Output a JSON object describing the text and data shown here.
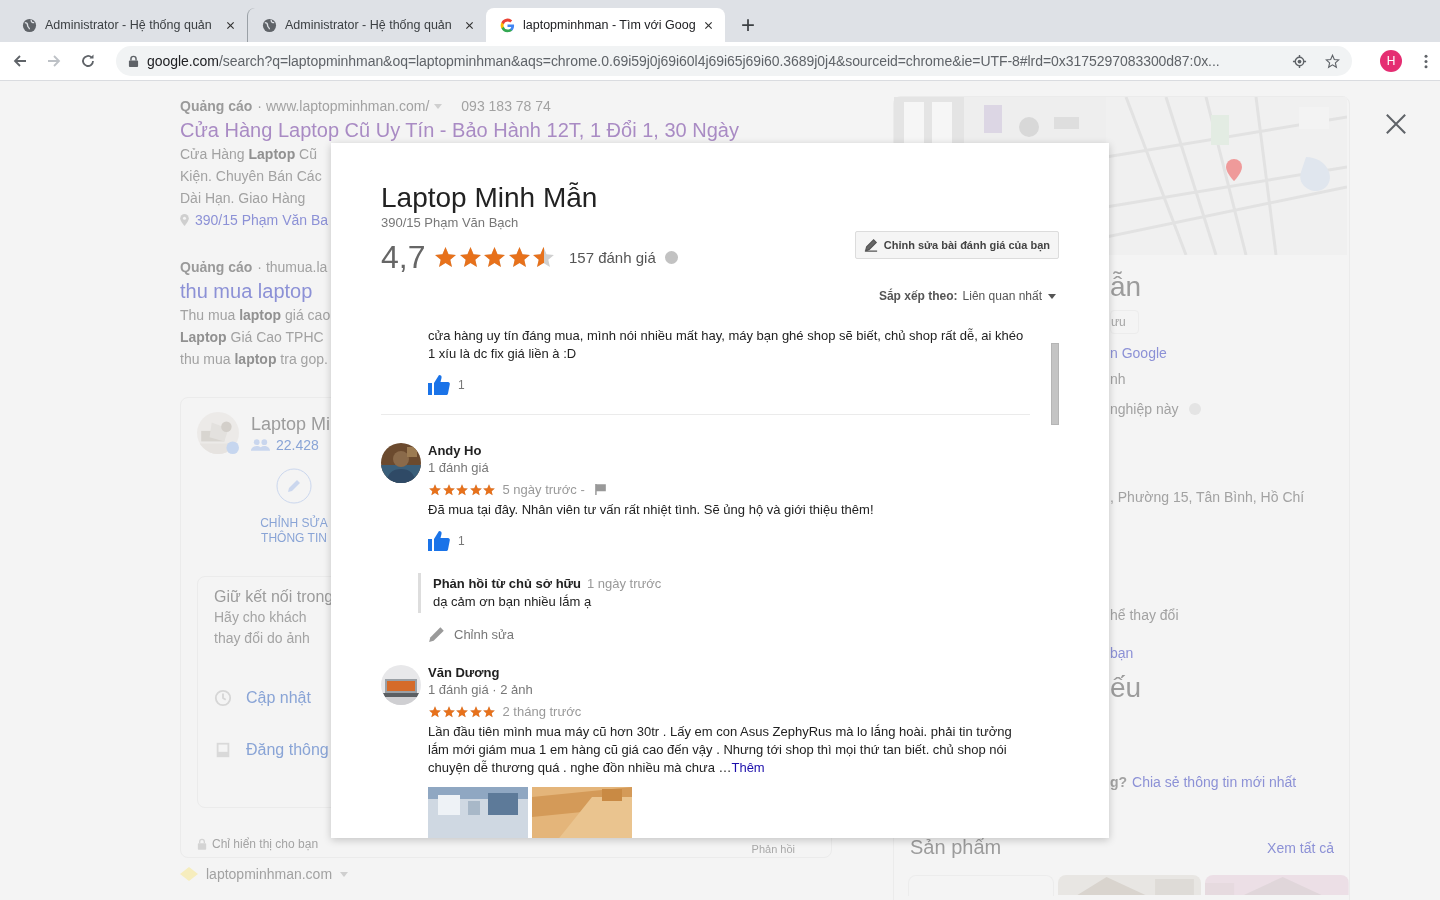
{
  "browser": {
    "tabs": [
      {
        "title": "Administrator - Hệ thống quản",
        "selected": false
      },
      {
        "title": "Administrator - Hệ thống quản",
        "selected": false
      },
      {
        "title": "laptopminhman - Tìm với Goog",
        "selected": true
      }
    ],
    "new_tab": "+",
    "address": {
      "host": "google.com",
      "path": "/search?q=laptopminhman&oq=laptopminhman&aqs=chrome.0.69i59j0j69i60l4j69i65j69i60.3689j0j4&sourceid=chrome&ie=UTF-8#lrd=0x3175297083300d87:0x..."
    },
    "profile_initial": "H"
  },
  "background": {
    "ads": [
      {
        "label": "Quảng cáo",
        "url": "· www.laptopminhman.com/",
        "phone": "093 183 78 74",
        "title": "Cửa Hàng Laptop Cũ Uy Tín - Bảo Hành 12T, 1 Đổi 1, 30 Ngày",
        "lines": [
          "Cửa Hàng **Laptop** Cũ",
          "Kiện. Chuyên Bán Các",
          "Dài Hạn. Giao Hàng"
        ],
        "address": "390/15 Phạm Văn Ba"
      },
      {
        "label": "Quảng cáo",
        "url": "· thumua.la",
        "title": "thu mua laptop",
        "lines": [
          "Thu mua **laptop** giá cao",
          "**Laptop** Giá Cao TPHC",
          "thu mua **laptop** tra gop."
        ]
      }
    ],
    "business": {
      "name": "Laptop Mi",
      "followers": "22.428",
      "edit_label": "CHỈNH SỬA THÔNG TIN",
      "update_title": "Giữ kết nối trong",
      "update_lines": [
        "Hãy cho khách",
        "thay đổi do ảnh"
      ],
      "actions": [
        {
          "kind": "hours",
          "label": "Cập nhật"
        },
        {
          "kind": "post",
          "label": "Đăng thông"
        }
      ],
      "private_note": "Chỉ hiển thị cho bạn",
      "feedback": "Phản hồi"
    },
    "result_site": "laptopminhman.com",
    "panel": {
      "fragments": [
        {
          "kind": "heading",
          "text": "ẫn"
        },
        {
          "kind": "chip",
          "text": "ưu"
        },
        {
          "kind": "link",
          "text": "n Google"
        },
        {
          "kind": "text",
          "text": "nh"
        },
        {
          "kind": "question",
          "text": "nghiệp này"
        },
        {
          "kind": "text",
          "text": ", Phường 15, Tân Bình, Hồ Chí"
        },
        {
          "kind": "text",
          "text": "hể thay đổi"
        },
        {
          "kind": "link",
          "text": "bạn"
        },
        {
          "kind": "heading",
          "text": "ếu"
        },
        {
          "kind": "prompt",
          "text": "g?",
          "link": "Chia sẻ thông tin mới nhất"
        }
      ],
      "products_title": "Sản phẩm",
      "products_link": "Xem tất cả"
    }
  },
  "modal": {
    "title": "Laptop Minh Mẫn",
    "address": "390/15 Phạm Văn Bạch",
    "rating": "4,7",
    "stars": 4.5,
    "count": "157 đánh giá",
    "edit_button": "Chỉnh sửa bài đánh giá của bạn",
    "sort_label": "Sắp xếp theo:",
    "sort_value": "Liên quan nhất",
    "reviews": [
      {
        "kind": "partial",
        "text": "cửa hàng uy tín đáng mua, mình nói nhiều mất hay, máy bạn ghé shop sẽ biết, chủ shop rất dễ, ai khéo 1 xíu là dc fix giá liền à :D",
        "likes": "1"
      },
      {
        "kind": "full",
        "author": "Andy Ho",
        "meta": "1 đánh giá",
        "stars": 5,
        "time": "5 ngày trước -",
        "flag": true,
        "text": "Đã mua tại đây. Nhân viên tư vấn rất nhiệt tình. Sẽ ủng hộ và giới thiệu thêm!",
        "likes": "1",
        "reply": {
          "label": "Phản hồi từ chủ sở hữu",
          "time": "1 ngày trước",
          "text": "dạ cảm ơn bạn nhiều lắm ạ",
          "edit": "Chỉnh sửa"
        }
      },
      {
        "kind": "full",
        "author": "Văn Dương",
        "meta": "1 đánh giá · 2 ảnh",
        "stars": 5,
        "time": "2 tháng trước",
        "text": "Lần đầu tiên mình mua máy cũ hơn 30tr . Lấy em con Asus ZephyRus mà lo lắng hoài. phải tin tưởng lắm mới giám mua 1 em hàng cũ giá cao đến vậy . Nhưng tới shop thì mọi thứ tan biết. chủ shop nói chuyện dễ thương quá . nghe đồn nhiều mà chưa …",
        "more": "Thêm",
        "photos": [
          {
            "kind": "picture"
          },
          {
            "kind": "picture"
          }
        ]
      }
    ]
  }
}
